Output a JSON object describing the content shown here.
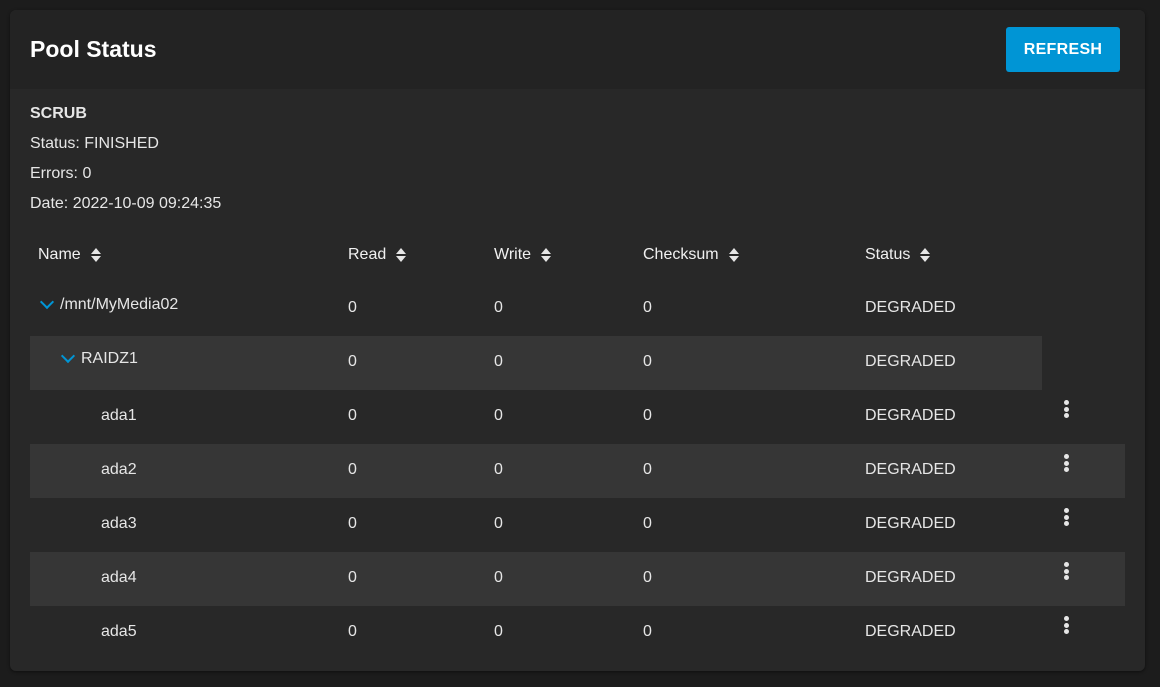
{
  "card": {
    "title": "Pool Status",
    "refresh_label": "REFRESH"
  },
  "scrub": {
    "title": "SCRUB",
    "status": "Status: FINISHED",
    "errors": "Errors: 0",
    "date": "Date: 2022-10-09 09:24:35"
  },
  "table": {
    "columns": [
      "Name",
      "Read",
      "Write",
      "Checksum",
      "Status"
    ],
    "rows": [
      {
        "name": "/mnt/MyMedia02",
        "read": "0",
        "write": "0",
        "checksum": "0",
        "status": "DEGRADED"
      },
      {
        "name": "RAIDZ1",
        "read": "0",
        "write": "0",
        "checksum": "0",
        "status": "DEGRADED"
      },
      {
        "name": "ada1",
        "read": "0",
        "write": "0",
        "checksum": "0",
        "status": "DEGRADED"
      },
      {
        "name": "ada2",
        "read": "0",
        "write": "0",
        "checksum": "0",
        "status": "DEGRADED"
      },
      {
        "name": "ada3",
        "read": "0",
        "write": "0",
        "checksum": "0",
        "status": "DEGRADED"
      },
      {
        "name": "ada4",
        "read": "0",
        "write": "0",
        "checksum": "0",
        "status": "DEGRADED"
      },
      {
        "name": "ada5",
        "read": "0",
        "write": "0",
        "checksum": "0",
        "status": "DEGRADED"
      }
    ]
  },
  "icons": {
    "sort": "sort-icon",
    "expand": "chevron-down-icon",
    "menu": "more-vert-icon"
  },
  "colors": {
    "accent": "#0095d5",
    "card_bg": "#282828",
    "row_shade": "#363636"
  }
}
